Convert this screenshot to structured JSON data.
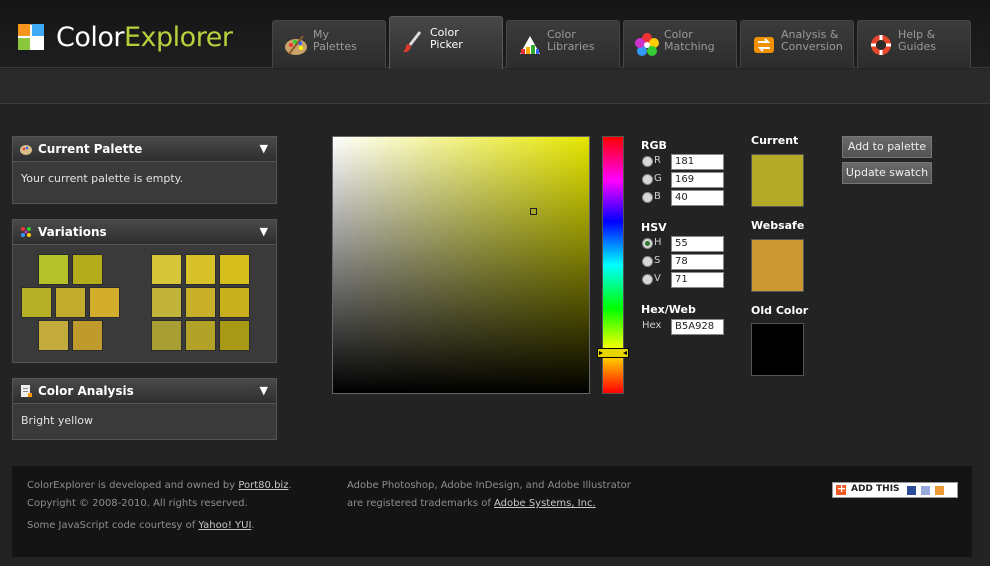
{
  "app": {
    "brand_part1": "Color",
    "brand_part2": "Explorer",
    "logo_icon": "colorexplorer-logo-icon"
  },
  "tabs": [
    {
      "line1": "My",
      "line2": "Palettes",
      "icon": "palette-icon",
      "active": false
    },
    {
      "line1": "Color",
      "line2": "Picker",
      "icon": "brush-icon",
      "active": true
    },
    {
      "line1": "Color",
      "line2": "Libraries",
      "icon": "swatch-book-icon",
      "active": false
    },
    {
      "line1": "Color",
      "line2": "Matching",
      "icon": "flower-icon",
      "active": false
    },
    {
      "line1": "Analysis &",
      "line2": "Conversion",
      "icon": "refresh-arrows-icon",
      "active": false
    },
    {
      "line1": "Help &",
      "line2": "Guides",
      "icon": "lifebuoy-icon",
      "active": false
    }
  ],
  "panels": {
    "current_palette": {
      "title": "Current Palette",
      "body": "Your current palette is empty."
    },
    "variations": {
      "title": "Variations"
    },
    "color_analysis": {
      "title": "Color Analysis",
      "body": "Bright yellow"
    }
  },
  "variations": {
    "left": [
      [
        "#b5c22a",
        "#b5ac1c"
      ],
      [
        "#b5b028",
        "#c2ac2c",
        "#d2ae2c"
      ],
      [
        "#c2aa3c",
        "#bf9a2c"
      ]
    ],
    "right": [
      [
        "#d6c63a",
        "#d8c22a",
        "#d6bf1c"
      ],
      [
        "#c2b43a",
        "#c9b02a",
        "#c8b01c"
      ],
      [
        "#a89e33",
        "#b2a227",
        "#a89a16"
      ]
    ]
  },
  "picker": {
    "rgb_title": "RGB",
    "hsv_title": "HSV",
    "hex_title": "Hex/Web",
    "r_label": "R",
    "r": "181",
    "g_label": "G",
    "g": "169",
    "b_label": "B",
    "b": "40",
    "h_label": "H",
    "h": "55",
    "s_label": "S",
    "s": "78",
    "v_label": "V",
    "v": "71",
    "hex_label": "Hex",
    "hex": "B5A928",
    "selected_mode": "H",
    "hue_color": "#e6e600"
  },
  "preview": {
    "current_title": "Current",
    "current_color": "#b5a928",
    "websafe_title": "Websafe",
    "websafe_color": "#cc9933",
    "old_title": "Old Color",
    "old_color": "#000000"
  },
  "buttons": {
    "add_to_palette": "Add to palette",
    "update_swatch": "Update swatch"
  },
  "footer": {
    "line1_prefix": "ColorExplorer is developed and owned by ",
    "line1_link": "Port80.biz",
    "line1_suffix": ".",
    "line2": "Copyright © 2008-2010. All rights reserved.",
    "line3_prefix": "Some JavaScript code courtesy of ",
    "line3_link": "Yahoo! YUI",
    "line3_suffix": ".",
    "adobe_line1": "Adobe Photoshop, Adobe InDesign, and Adobe Illustrator",
    "adobe_line2_prefix": "are registered trademarks of ",
    "adobe_line2_link": "Adobe Systems, Inc.",
    "addthis_label": "ADD THIS"
  }
}
